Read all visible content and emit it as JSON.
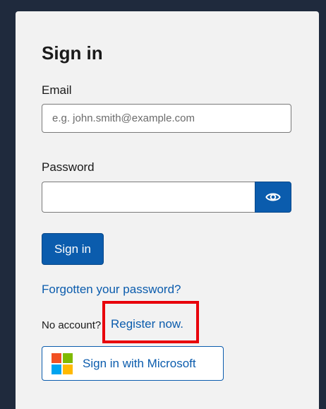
{
  "form": {
    "title": "Sign in",
    "email_label": "Email",
    "email_placeholder": "e.g. john.smith@example.com",
    "email_value": "",
    "password_label": "Password",
    "password_value": "",
    "show_password_icon": "eye-icon",
    "signin_label": "Sign in",
    "forgot_link": "Forgotten your password?",
    "no_account_text": "No account?",
    "register_link": "Register now.",
    "microsoft_label": "Sign in with Microsoft",
    "microsoft_logo_colors": [
      "#f25022",
      "#7fba00",
      "#00a4ef",
      "#ffb900"
    ]
  },
  "colors": {
    "primary": "#0b5cad",
    "highlight": "#e8000b",
    "background": "#1f2a3d",
    "card": "#f2f2f2"
  }
}
